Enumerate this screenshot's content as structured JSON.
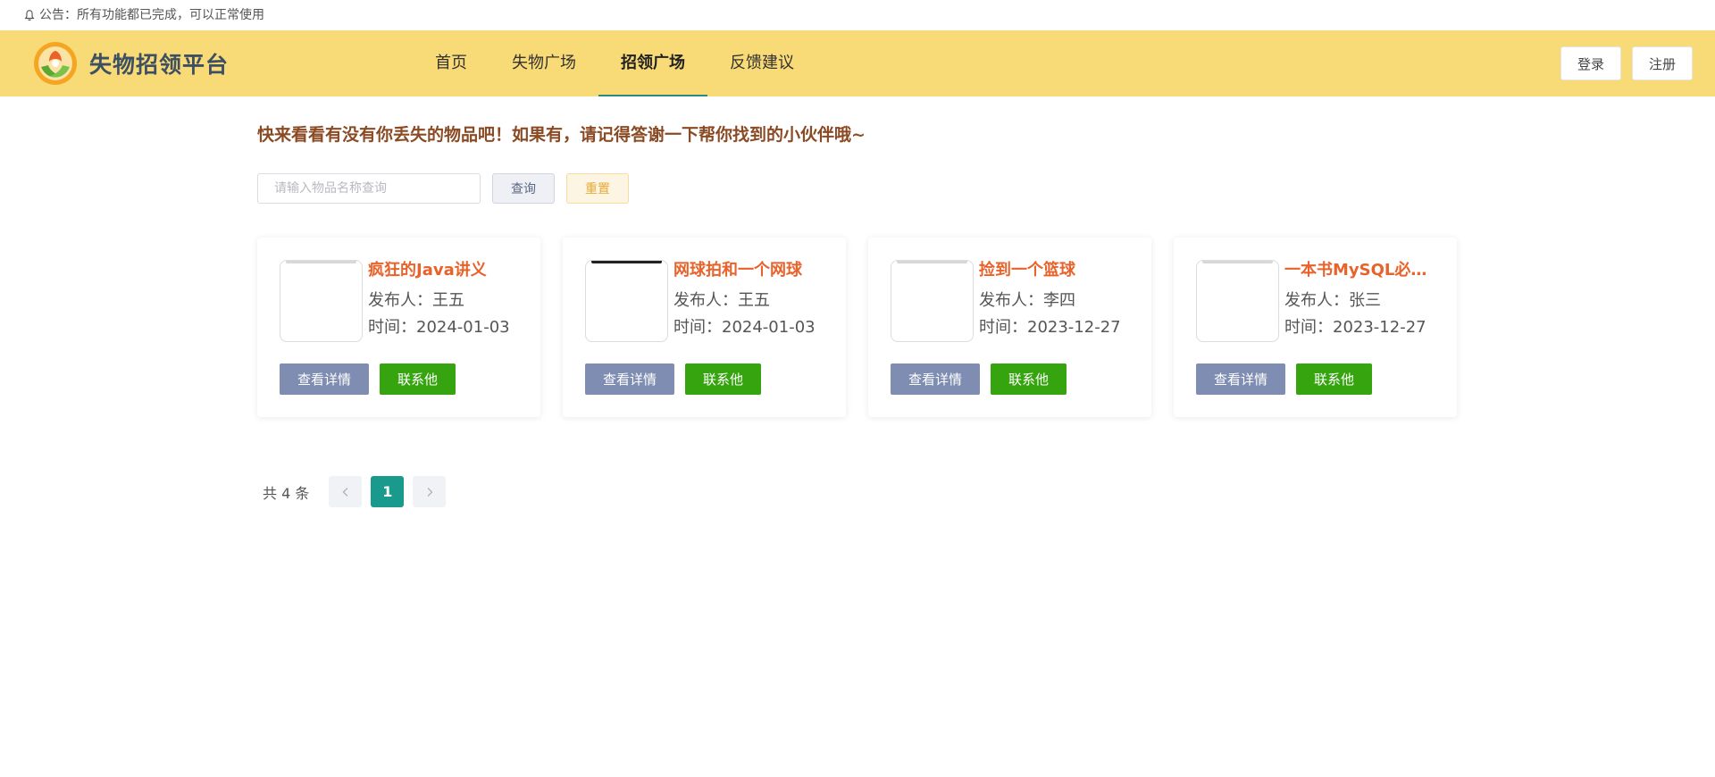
{
  "notice": {
    "text": "公告：所有功能都已完成，可以正常使用",
    "icon": "bell-icon"
  },
  "header": {
    "brand_title": "失物招领平台",
    "nav": [
      {
        "label": "首页",
        "active": false
      },
      {
        "label": "失物广场",
        "active": false
      },
      {
        "label": "招领广场",
        "active": true
      },
      {
        "label": "反馈建议",
        "active": false
      }
    ],
    "login_label": "登录",
    "register_label": "注册"
  },
  "main": {
    "slogan": "快来看看有没有你丢失的物品吧！如果有，请记得答谢一下帮你找到的小伙伴哦~",
    "search": {
      "placeholder": "请输入物品名称查询",
      "value": "",
      "query_label": "查询",
      "reset_label": "重置"
    },
    "cards": [
      {
        "title": "疯狂的Java讲义",
        "publisher": "发布人：王五",
        "time": "时间：2024-01-03",
        "detail_label": "查看详情",
        "contact_label": "联系他"
      },
      {
        "title": "网球拍和一个网球",
        "publisher": "发布人：王五",
        "time": "时间：2024-01-03",
        "detail_label": "查看详情",
        "contact_label": "联系他"
      },
      {
        "title": "捡到一个篮球",
        "publisher": "发布人：李四",
        "time": "时间：2023-12-27",
        "detail_label": "查看详情",
        "contact_label": "联系他"
      },
      {
        "title": "一本书MySQL必知必会",
        "publisher": "发布人：张三",
        "time": "时间：2023-12-27",
        "detail_label": "查看详情",
        "contact_label": "联系他"
      }
    ],
    "pagination": {
      "total_text": "共 4 条",
      "current_page": "1"
    }
  },
  "colors": {
    "header_bg": "#f8da76",
    "brand_text": "#3d4f63",
    "slogan": "#8a4a24",
    "item_title": "#e8622a",
    "detail_button": "#7e8db1",
    "contact_button": "#36a40f",
    "page_active": "#1a9a8d",
    "nav_underline": "#2b8a78"
  }
}
